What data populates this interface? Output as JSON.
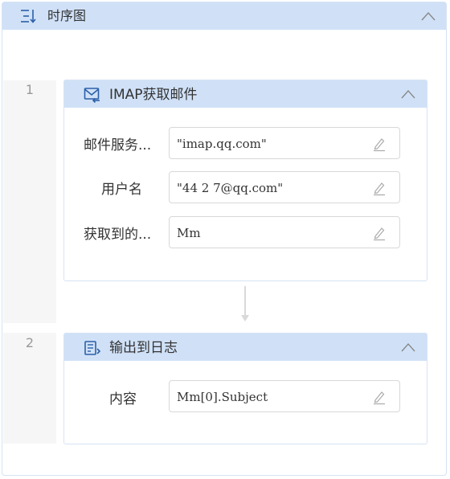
{
  "header": {
    "title": "时序图",
    "icon": "sequence-list-icon"
  },
  "steps": [
    {
      "number": "1",
      "title": "IMAP获取邮件",
      "icon": "mail-receive-icon",
      "fields": [
        {
          "label": "邮件服务...",
          "value": "\"imap.qq.com\""
        },
        {
          "label": "用户名",
          "value": "\"44  2  7@qq.com\""
        },
        {
          "label": "获取到的...",
          "value": "Mm"
        }
      ]
    },
    {
      "number": "2",
      "title": "输出到日志",
      "icon": "log-output-icon",
      "fields": [
        {
          "label": "内容",
          "value": "Mm[0].Subject"
        }
      ]
    }
  ],
  "colors": {
    "header_bg": "#d0e1f7",
    "border": "#d6e3f3",
    "gutter_bg": "#f6f6f6",
    "icon": "#2b5fa8"
  }
}
